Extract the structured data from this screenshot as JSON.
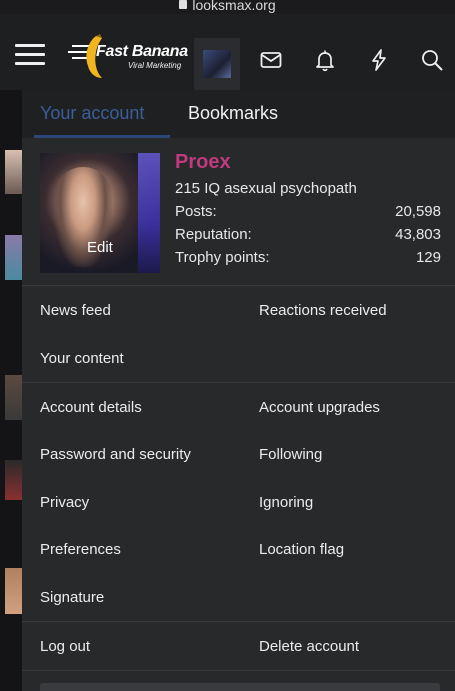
{
  "browser": {
    "url": "looksmax.org"
  },
  "topbar": {
    "logo_title": "Fast Banana",
    "logo_subtitle": "Viral Marketing",
    "icons": [
      "menu-icon",
      "avatar",
      "envelope-icon",
      "bell-icon",
      "lightning-icon",
      "search-icon"
    ]
  },
  "tabs": [
    {
      "label": "Your account",
      "active": true
    },
    {
      "label": "Bookmarks",
      "active": false
    }
  ],
  "profile": {
    "edit_label": "Edit",
    "username": "Proex",
    "username_color": "#c03a7d",
    "user_title": "215 IQ asexual psychopath",
    "stats": [
      {
        "label": "Posts:",
        "value": "20,598"
      },
      {
        "label": "Reputation:",
        "value": "43,803"
      },
      {
        "label": "Trophy points:",
        "value": "129"
      }
    ]
  },
  "menu": {
    "news_feed": "News feed",
    "reactions_received": "Reactions received",
    "your_content": "Your content",
    "account_details": "Account details",
    "account_upgrades": "Account upgrades",
    "password_security": "Password and security",
    "following": "Following",
    "privacy": "Privacy",
    "ignoring": "Ignoring",
    "preferences": "Preferences",
    "location_flag": "Location flag",
    "signature": "Signature",
    "log_out": "Log out",
    "delete_account": "Delete account"
  },
  "colors": {
    "accent": "#3b5e99",
    "panel_bg": "#28292b",
    "header_bg": "#1e1f21"
  }
}
